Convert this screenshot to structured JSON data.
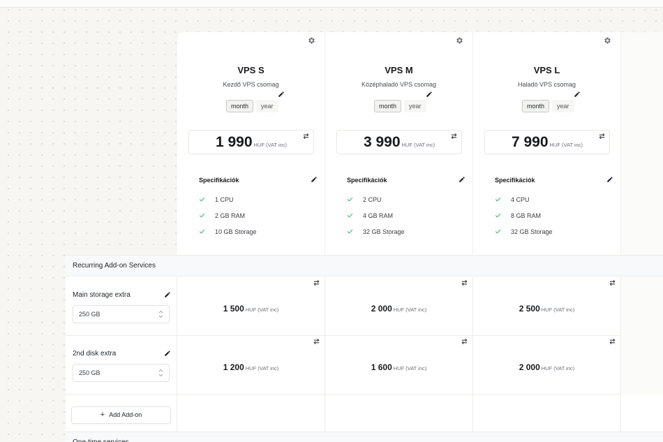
{
  "plans": [
    {
      "name": "VPS S",
      "subtitle": "Kezdő VPS csomag",
      "period_month": "month",
      "period_year": "year",
      "price": "1 990",
      "unit": "HUF (VAT inc)",
      "spec_title": "Specifikációk",
      "specs": [
        "1 CPU",
        "2 GB RAM",
        "10 GB Storage"
      ]
    },
    {
      "name": "VPS M",
      "subtitle": "Középhaladó VPS csomag",
      "period_month": "month",
      "period_year": "year",
      "price": "3 990",
      "unit": "HUF (VAT inc)",
      "spec_title": "Specifikációk",
      "specs": [
        "2 CPU",
        "4 GB RAM",
        "32 GB Storage"
      ]
    },
    {
      "name": "VPS L",
      "subtitle": "Haladó VPS csomag",
      "period_month": "month",
      "period_year": "year",
      "price": "7 990",
      "unit": "HUF (VAT inc)",
      "spec_title": "Specifikációk",
      "specs": [
        "4 CPU",
        "8 GB RAM",
        "32 GB Storage"
      ]
    }
  ],
  "addons": {
    "header": "Recurring Add-on Services",
    "rows": [
      {
        "name": "Main storage extra",
        "selected": "250 GB",
        "prices": [
          "1 500",
          "2 000",
          "2 500"
        ],
        "unit": "HUF (VAT inc)"
      },
      {
        "name": "2nd disk extra",
        "selected": "250 GB",
        "prices": [
          "1 200",
          "1 600",
          "2 000"
        ],
        "unit": "HUF (VAT inc)"
      }
    ],
    "add_label": "Add Add-on",
    "add_icon": "+"
  },
  "onetime": {
    "header": "One-time services"
  },
  "colors": {
    "check": "#2fbf6a",
    "header_bg": "#f8f9fa",
    "canvas_bg": "#f7f6f3"
  }
}
